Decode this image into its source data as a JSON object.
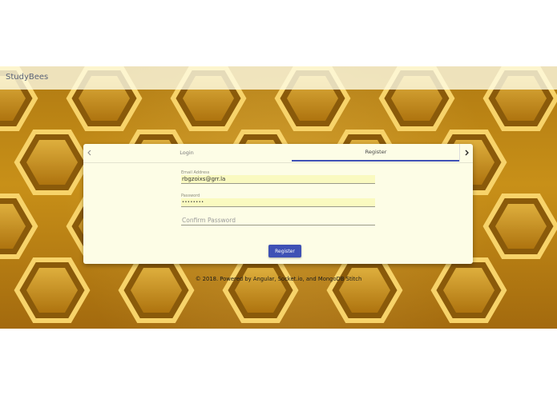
{
  "app": {
    "brand": "StudyBees"
  },
  "tabs": [
    {
      "label": "Login"
    },
    {
      "label": "Register"
    }
  ],
  "icons": {
    "prev": "chevron-left-icon",
    "next": "chevron-right-icon"
  },
  "form": {
    "email": {
      "label": "Email Address",
      "value": "rbgzoixs@grr.la"
    },
    "password": {
      "label": "Password",
      "value": "••••••••"
    },
    "confirm": {
      "placeholder": "Confirm Password"
    },
    "submit_label": "Register"
  },
  "footer": {
    "text": "© 2018. Powered by Angular, Socket.io, and MongoDB Stitch"
  },
  "colors": {
    "accent": "#3f51b5",
    "card": "#fdfde6",
    "honey": "#c89018"
  }
}
